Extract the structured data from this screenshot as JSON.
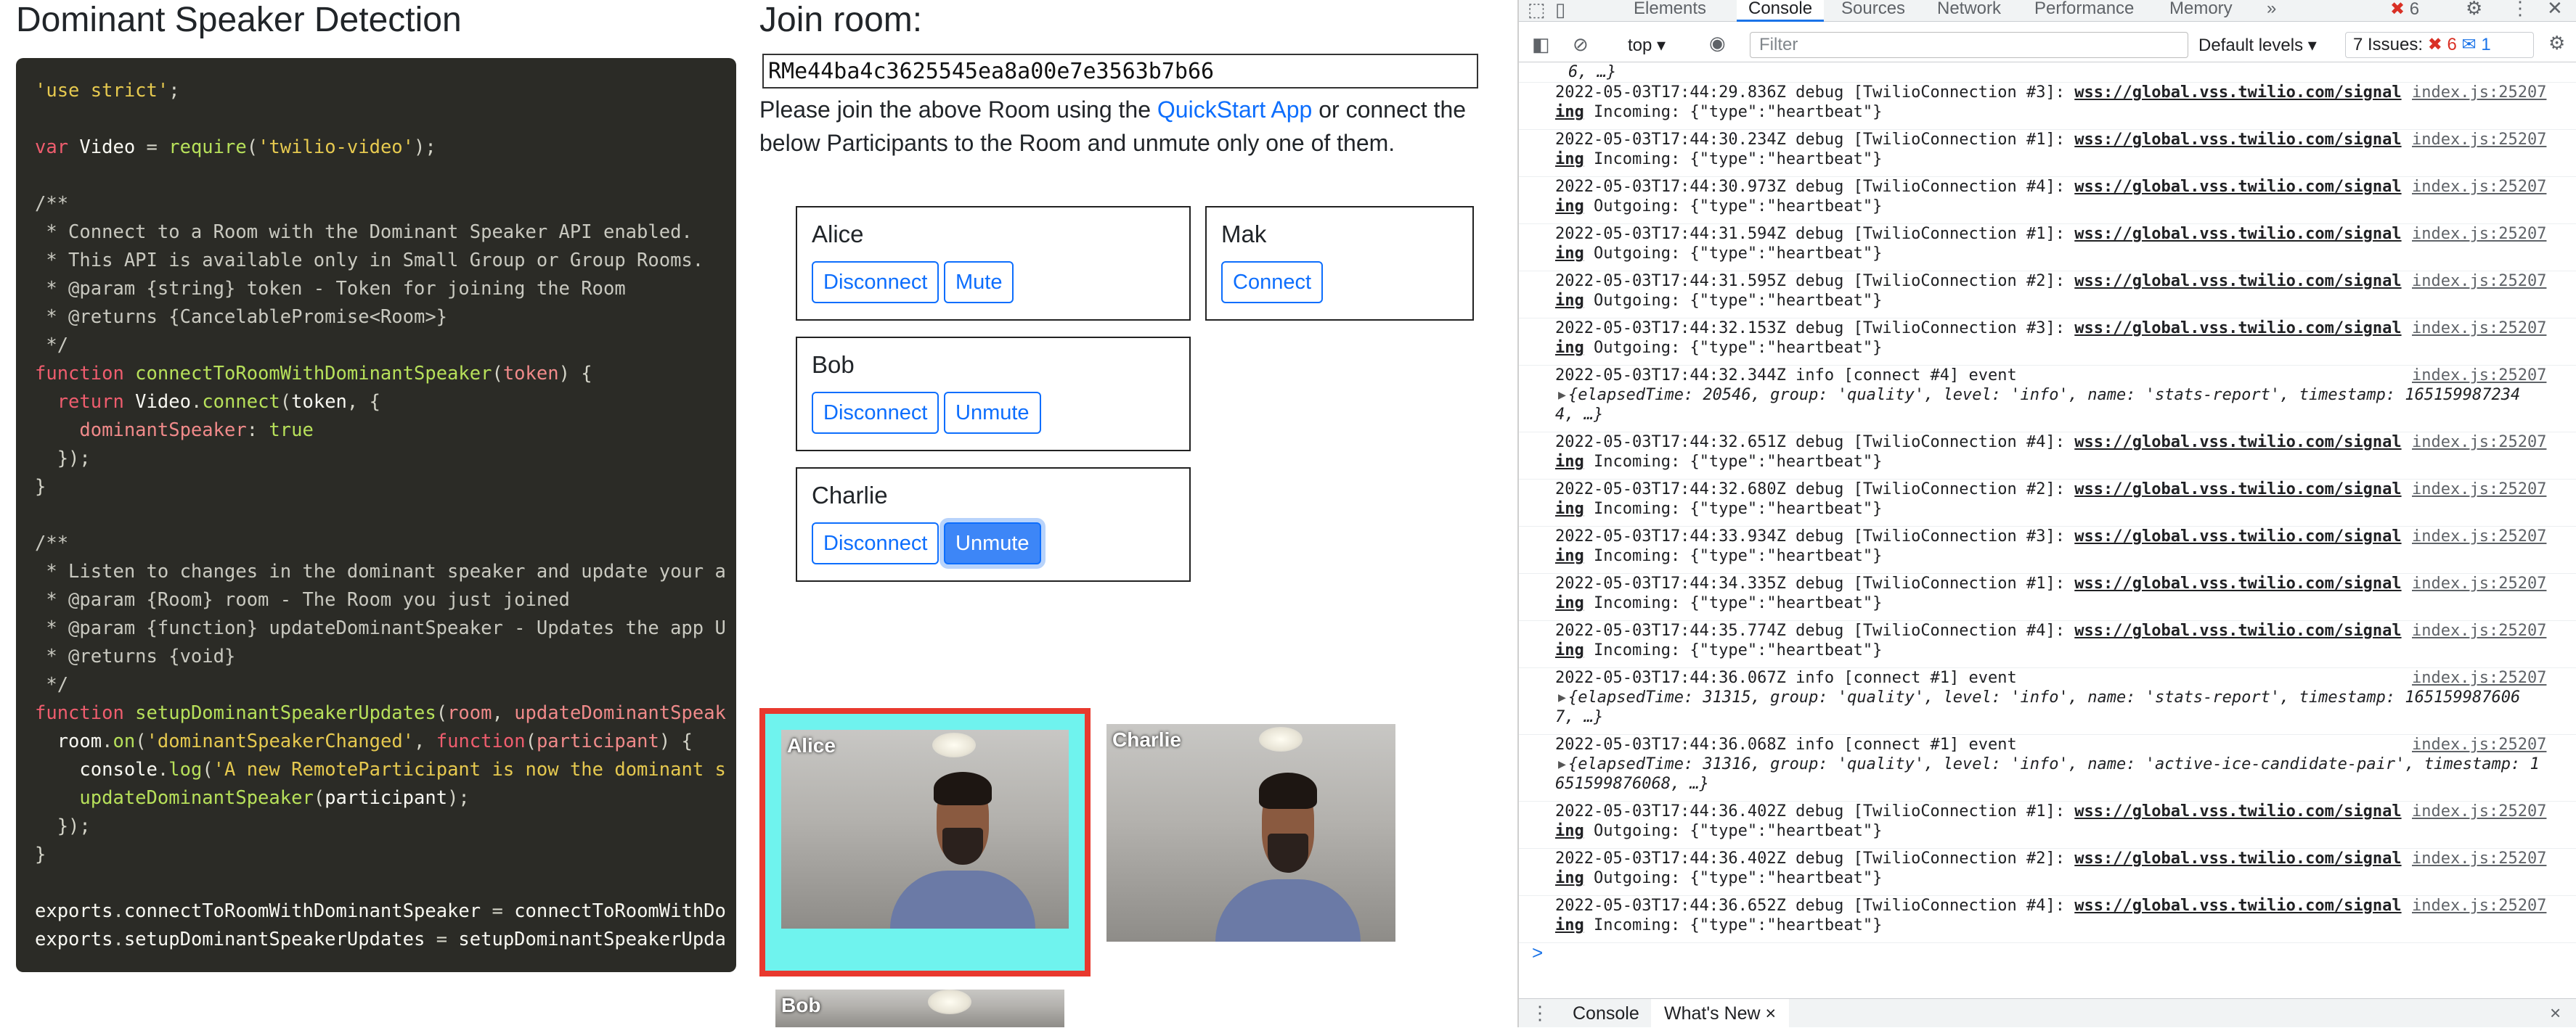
{
  "app": {
    "title": "Dominant Speaker Detection",
    "code_lines": [
      [
        [
          "s",
          "'use strict'"
        ],
        [
          "m",
          ";"
        ]
      ],
      [],
      [
        [
          "k",
          "var"
        ],
        [
          "fn",
          " Video "
        ],
        [
          "m",
          "= "
        ],
        [
          "t",
          "require"
        ],
        [
          "m",
          "("
        ],
        [
          "s",
          "'twilio-video'"
        ],
        [
          "m",
          ");"
        ]
      ],
      [],
      [
        [
          "c",
          "/**"
        ]
      ],
      [
        [
          "c",
          " * Connect to a Room with the Dominant Speaker API enabled."
        ]
      ],
      [
        [
          "c",
          " * This API is available only in Small Group or Group Rooms."
        ]
      ],
      [
        [
          "c",
          " * @param {string} token - Token for joining the Room"
        ]
      ],
      [
        [
          "c",
          " * @returns {CancelablePromise<Room>}"
        ]
      ],
      [
        [
          "c",
          " */"
        ]
      ],
      [
        [
          "k",
          "function"
        ],
        [
          "t",
          " connectToRoomWithDominantSpeaker"
        ],
        [
          "m",
          "("
        ],
        [
          "p",
          "token"
        ],
        [
          "m",
          ") {"
        ]
      ],
      [
        [
          "k",
          "  return"
        ],
        [
          "fn",
          " Video"
        ],
        [
          "m",
          "."
        ],
        [
          "t",
          "connect"
        ],
        [
          "m",
          "("
        ],
        [
          "fn",
          "token"
        ],
        [
          "m",
          ", {"
        ]
      ],
      [
        [
          "p",
          "    dominantSpeaker"
        ],
        [
          "m",
          ": "
        ],
        [
          "t",
          "true"
        ]
      ],
      [
        [
          "m",
          "  });"
        ]
      ],
      [
        [
          "m",
          "}"
        ]
      ],
      [],
      [
        [
          "c",
          "/**"
        ]
      ],
      [
        [
          "c",
          " * Listen to changes in the dominant speaker and update your a"
        ]
      ],
      [
        [
          "c",
          " * @param {Room} room - The Room you just joined"
        ]
      ],
      [
        [
          "c",
          " * @param {function} updateDominantSpeaker - Updates the app U"
        ]
      ],
      [
        [
          "c",
          " * @returns {void}"
        ]
      ],
      [
        [
          "c",
          " */"
        ]
      ],
      [
        [
          "k",
          "function"
        ],
        [
          "t",
          " setupDominantSpeakerUpdates"
        ],
        [
          "m",
          "("
        ],
        [
          "p",
          "room"
        ],
        [
          "m",
          ", "
        ],
        [
          "p",
          "updateDominantSpeak"
        ]
      ],
      [
        [
          "fn",
          "  room"
        ],
        [
          "m",
          "."
        ],
        [
          "t",
          "on"
        ],
        [
          "m",
          "("
        ],
        [
          "s",
          "'dominantSpeakerChanged'"
        ],
        [
          "m",
          ", "
        ],
        [
          "k",
          "function"
        ],
        [
          "m",
          "("
        ],
        [
          "p",
          "participant"
        ],
        [
          "m",
          ") {"
        ]
      ],
      [
        [
          "fn",
          "    console"
        ],
        [
          "m",
          "."
        ],
        [
          "t",
          "log"
        ],
        [
          "m",
          "("
        ],
        [
          "s",
          "'A new RemoteParticipant is now the dominant s"
        ]
      ],
      [
        [
          "t",
          "    updateDominantSpeaker"
        ],
        [
          "m",
          "("
        ],
        [
          "fn",
          "participant"
        ],
        [
          "m",
          ");"
        ]
      ],
      [
        [
          "m",
          "  });"
        ]
      ],
      [
        [
          "m",
          "}"
        ]
      ],
      [],
      [
        [
          "fn",
          "exports"
        ],
        [
          "m",
          "."
        ],
        [
          "fn",
          "connectToRoomWithDominantSpeaker "
        ],
        [
          "m",
          "= "
        ],
        [
          "fn",
          "connectToRoomWithDo"
        ]
      ],
      [
        [
          "fn",
          "exports"
        ],
        [
          "m",
          "."
        ],
        [
          "fn",
          "setupDominantSpeakerUpdates "
        ],
        [
          "m",
          "= "
        ],
        [
          "fn",
          "setupDominantSpeakerUpda"
        ]
      ]
    ],
    "join_heading": "Join room:",
    "room_name": "RMe44ba4c3625545ea8a00e7e3563b7b66",
    "note_pre": "Please join the above Room using the ",
    "note_link": "QuickStart App",
    "note_post": " or connect the below Participants to the Room and unmute only one of them.",
    "participants": {
      "alice": {
        "name": "Alice",
        "btn1": "Disconnect",
        "btn2": "Mute"
      },
      "mak": {
        "name": "Mak",
        "btn1": "Connect"
      },
      "bob": {
        "name": "Bob",
        "btn1": "Disconnect",
        "btn2": "Unmute"
      },
      "charlie": {
        "name": "Charlie",
        "btn1": "Disconnect",
        "btn2": "Unmute"
      }
    },
    "videos": {
      "alice": "Alice",
      "charlie": "Charlie",
      "bob": "Bob"
    },
    "dominant_border_color": "#e8392e",
    "dominant_fill_color": "#6ff3ee"
  },
  "devtools": {
    "tabs": [
      "Elements",
      "Console",
      "Sources",
      "Network",
      "Performance",
      "Memory",
      "»"
    ],
    "error_count": "6",
    "context": "top ▾",
    "filter_placeholder": "Filter",
    "levels": "Default levels ▾",
    "issues_label": "7 Issues:",
    "issues_err": "6",
    "issues_info": "1",
    "first_fragment": "6, …}",
    "logs": [
      {
        "a": "2022-05-03T17:44:29.836Z debug [TwilioConnection #3]: ",
        "u": "wss://global.vss.twilio.com/signal",
        "b": "ing",
        "c": " Incoming: {\"type\":\"heartbeat\"}"
      },
      {
        "a": "2022-05-03T17:44:30.234Z debug [TwilioConnection #1]: ",
        "u": "wss://global.vss.twilio.com/signal",
        "b": "ing",
        "c": " Incoming: {\"type\":\"heartbeat\"}"
      },
      {
        "a": "2022-05-03T17:44:30.973Z debug [TwilioConnection #4]: ",
        "u": "wss://global.vss.twilio.com/signal",
        "b": "ing",
        "c": " Outgoing: {\"type\":\"heartbeat\"}"
      },
      {
        "a": "2022-05-03T17:44:31.594Z debug [TwilioConnection #1]: ",
        "u": "wss://global.vss.twilio.com/signal",
        "b": "ing",
        "c": " Outgoing: {\"type\":\"heartbeat\"}"
      },
      {
        "a": "2022-05-03T17:44:31.595Z debug [TwilioConnection #2]: ",
        "u": "wss://global.vss.twilio.com/signal",
        "b": "ing",
        "c": " Outgoing: {\"type\":\"heartbeat\"}"
      },
      {
        "a": "2022-05-03T17:44:32.153Z debug [TwilioConnection #3]: ",
        "u": "wss://global.vss.twilio.com/signal",
        "b": "ing",
        "c": " Outgoing: {\"type\":\"heartbeat\"}"
      },
      {
        "ev": true,
        "a": "2022-05-03T17:44:32.344Z info [connect #4] event",
        "o": "{elapsedTime: 20546, group: 'quality', level: 'info', name: 'stats-report', timestamp: 165159987234",
        "o2": "4, …}"
      },
      {
        "a": "2022-05-03T17:44:32.651Z debug [TwilioConnection #4]: ",
        "u": "wss://global.vss.twilio.com/signal",
        "b": "ing",
        "c": " Incoming: {\"type\":\"heartbeat\"}"
      },
      {
        "a": "2022-05-03T17:44:32.680Z debug [TwilioConnection #2]: ",
        "u": "wss://global.vss.twilio.com/signal",
        "b": "ing",
        "c": " Incoming: {\"type\":\"heartbeat\"}"
      },
      {
        "a": "2022-05-03T17:44:33.934Z debug [TwilioConnection #3]: ",
        "u": "wss://global.vss.twilio.com/signal",
        "b": "ing",
        "c": " Incoming: {\"type\":\"heartbeat\"}"
      },
      {
        "a": "2022-05-03T17:44:34.335Z debug [TwilioConnection #1]: ",
        "u": "wss://global.vss.twilio.com/signal",
        "b": "ing",
        "c": " Incoming: {\"type\":\"heartbeat\"}"
      },
      {
        "a": "2022-05-03T17:44:35.774Z debug [TwilioConnection #4]: ",
        "u": "wss://global.vss.twilio.com/signal",
        "b": "ing",
        "c": " Incoming: {\"type\":\"heartbeat\"}"
      },
      {
        "ev": true,
        "a": "2022-05-03T17:44:36.067Z info [connect #1] event",
        "o": "{elapsedTime: 31315, group: 'quality', level: 'info', name: 'stats-report', timestamp: 165159987606",
        "o2": "7, …}"
      },
      {
        "ev": true,
        "a": "2022-05-03T17:44:36.068Z info [connect #1] event",
        "o": "{elapsedTime: 31316, group: 'quality', level: 'info', name: 'active-ice-candidate-pair', timestamp: 1",
        "o2": "651599876068, …}"
      },
      {
        "a": "2022-05-03T17:44:36.402Z debug [TwilioConnection #1]: ",
        "u": "wss://global.vss.twilio.com/signal",
        "b": "ing",
        "c": " Outgoing: {\"type\":\"heartbeat\"}"
      },
      {
        "a": "2022-05-03T17:44:36.402Z debug [TwilioConnection #2]: ",
        "u": "wss://global.vss.twilio.com/signal",
        "b": "ing",
        "c": " Outgoing: {\"type\":\"heartbeat\"}"
      },
      {
        "a": "2022-05-03T17:44:36.652Z debug [TwilioConnection #4]: ",
        "u": "wss://global.vss.twilio.com/signal",
        "b": "ing",
        "c": " Incoming: {\"type\":\"heartbeat\"}"
      }
    ],
    "source_link": "index.js:25207",
    "prompt": ">",
    "bottom_tabs": [
      "Console",
      "What's New"
    ],
    "close_glyph": "×"
  }
}
